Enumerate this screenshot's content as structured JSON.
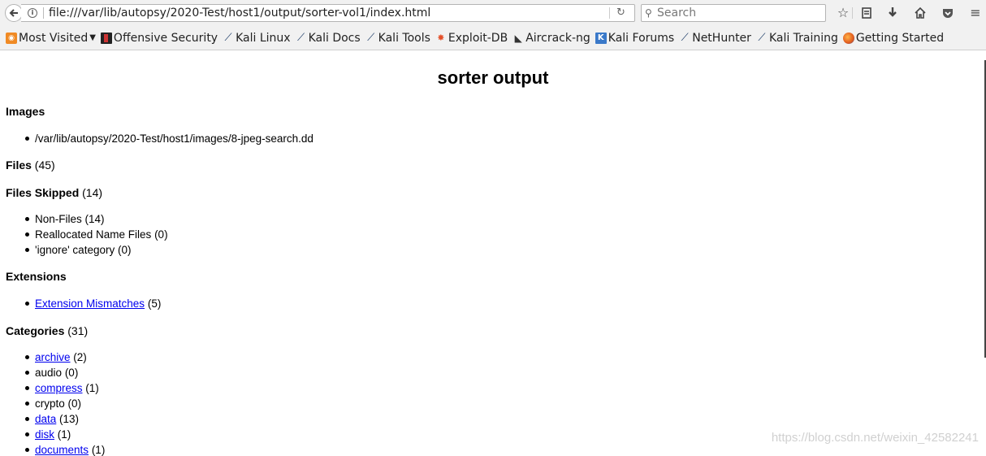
{
  "toolbar": {
    "url": "file:///var/lib/autopsy/2020-Test/host1/output/sorter-vol1/index.html",
    "search_placeholder": "Search"
  },
  "bookmarks": [
    {
      "label": "Most Visited",
      "icon": "rss-icon"
    },
    {
      "label": "Offensive Security",
      "icon": "offsec-icon"
    },
    {
      "label": "Kali Linux",
      "icon": "kali-dragon-icon"
    },
    {
      "label": "Kali Docs",
      "icon": "kali-dragon-icon"
    },
    {
      "label": "Kali Tools",
      "icon": "kali-dragon-icon"
    },
    {
      "label": "Exploit-DB",
      "icon": "exploit-db-icon"
    },
    {
      "label": "Aircrack-ng",
      "icon": "aircrack-icon"
    },
    {
      "label": "Kali Forums",
      "icon": "kali-forums-icon"
    },
    {
      "label": "NetHunter",
      "icon": "kali-dragon-icon"
    },
    {
      "label": "Kali Training",
      "icon": "kali-dragon-icon"
    },
    {
      "label": "Getting Started",
      "icon": "firefox-icon"
    }
  ],
  "page": {
    "title": "sorter output",
    "images": {
      "heading": "Images",
      "items": [
        "/var/lib/autopsy/2020-Test/host1/images/8-jpeg-search.dd"
      ]
    },
    "files": {
      "heading": "Files",
      "count": "(45)"
    },
    "files_skipped": {
      "heading": "Files Skipped",
      "count": "(14)",
      "items": [
        "Non-Files (14)",
        "Reallocated Name Files (0)",
        "'ignore' category (0)"
      ]
    },
    "extensions": {
      "heading": "Extensions",
      "items": [
        {
          "link": "Extension Mismatches",
          "count": "(5)"
        }
      ]
    },
    "categories": {
      "heading": "Categories",
      "count": "(31)",
      "items": [
        {
          "label": "archive",
          "count": "(2)",
          "link": true
        },
        {
          "label": "audio",
          "count": "(0)",
          "link": false
        },
        {
          "label": "compress",
          "count": "(1)",
          "link": true
        },
        {
          "label": "crypto",
          "count": "(0)",
          "link": false
        },
        {
          "label": "data",
          "count": "(13)",
          "link": true
        },
        {
          "label": "disk",
          "count": "(1)",
          "link": true
        },
        {
          "label": "documents",
          "count": "(1)",
          "link": true
        }
      ]
    }
  },
  "watermark": "https://blog.csdn.net/weixin_42582241"
}
